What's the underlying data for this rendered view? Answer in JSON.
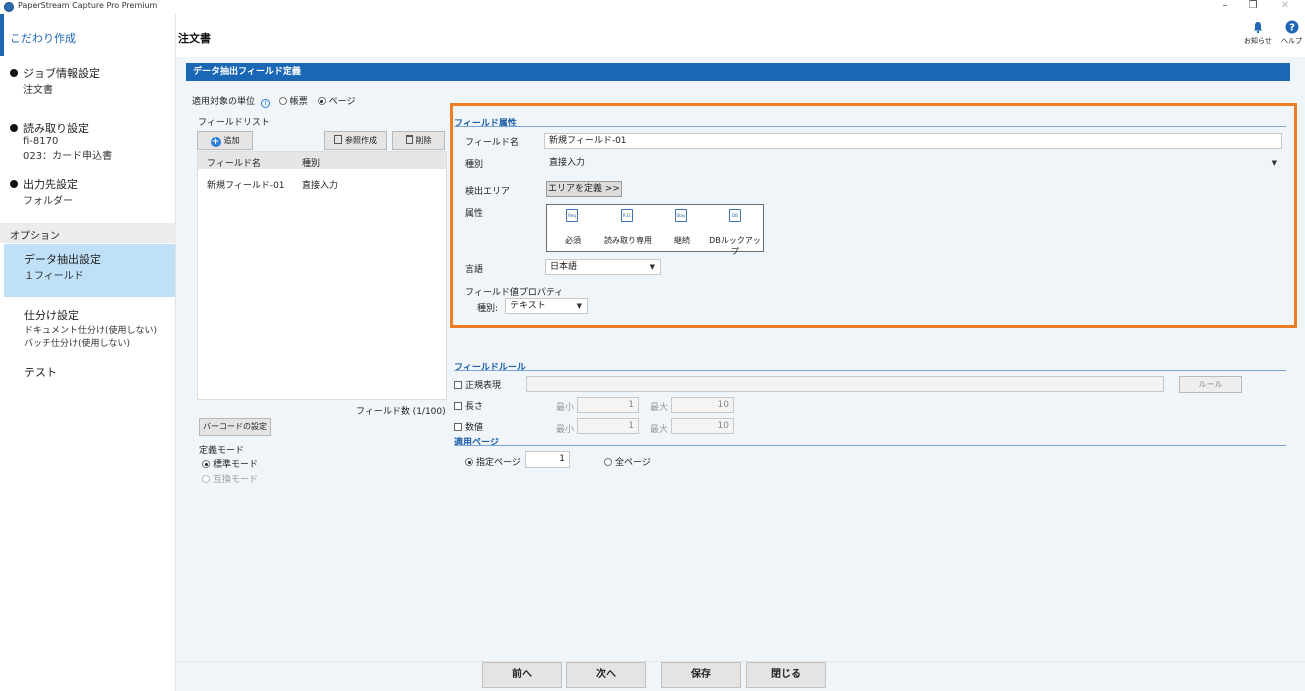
{
  "window": {
    "title": "PaperStream Capture Pro Premium"
  },
  "sidebar": {
    "header": "こだわり作成",
    "steps": [
      {
        "label": "ジョブ情報設定",
        "sub": [
          "注文書"
        ]
      },
      {
        "label": "読み取り設定",
        "sub": [
          "fi-8170",
          "023：カード申込書"
        ]
      },
      {
        "label": "出力先設定",
        "sub": [
          "フォルダー"
        ]
      }
    ],
    "options_label": "オプション",
    "options": [
      {
        "label": "データ抽出設定",
        "sub": [
          "１フィールド"
        ]
      },
      {
        "label": "仕分け設定",
        "sub": [
          "ドキュメント仕分け(使用しない)",
          "バッチ仕分け(使用しない)"
        ]
      },
      {
        "label": "テスト",
        "sub": []
      }
    ]
  },
  "header": {
    "title": "注文書",
    "notice_label": "お知らせ",
    "help_label": "ヘルプ"
  },
  "section_title": "データ抽出フィールド定義",
  "unit": {
    "label": "適用対象の単位",
    "options": [
      "帳票",
      "ページ"
    ],
    "selected": "ページ"
  },
  "field_list": {
    "label": "フィールドリスト",
    "add_label": "追加",
    "ref_label": "参照作成",
    "delete_label": "削除",
    "columns": [
      "フィールド名",
      "種別"
    ],
    "rows": [
      {
        "name": "新規フィールド-01",
        "type": "直接入力"
      }
    ],
    "count_text": "フィールド数 (1/100)",
    "barcode_label": "バーコードの設定",
    "mode_label": "定義モード",
    "modes": [
      "標準モード",
      "互換モード"
    ]
  },
  "field_attr": {
    "section": "フィールド属性",
    "name_label": "フィールド名",
    "name_value": "新規フィールド-01",
    "type_label": "種別",
    "type_value": "直接入力",
    "area_label": "検出エリア",
    "area_button": "エリアを定義 >>",
    "attr_label": "属性",
    "attrs": [
      {
        "icon": "Req",
        "label": "必須"
      },
      {
        "icon": "R.O.",
        "label": "読み取り専用"
      },
      {
        "icon": "Stay",
        "label": "継続"
      },
      {
        "icon": "DB",
        "label": "DBルックアップ"
      }
    ],
    "lang_label": "言語",
    "lang_value": "日本語",
    "value_prop_label": "フィールド値プロパティ",
    "kind_label": "種別:",
    "kind_value": "テキスト"
  },
  "field_rule": {
    "section": "フィールドルール",
    "regex_label": "正規表現",
    "rule_button": "ルール",
    "length_label": "長さ",
    "number_label": "数値",
    "min_label": "最小",
    "max_label": "最大",
    "length_min": "1",
    "length_max": "10",
    "number_min": "1",
    "number_max": "10"
  },
  "apply_page": {
    "section": "適用ページ",
    "specified_label": "指定ページ",
    "specified_value": "1",
    "all_label": "全ページ"
  },
  "footer": {
    "prev": "前へ",
    "next": "次へ",
    "save": "保存",
    "close": "閉じる"
  },
  "colors": {
    "accent": "#1a67b6",
    "highlight": "#ef7d24",
    "active": "#bfe0f7"
  }
}
